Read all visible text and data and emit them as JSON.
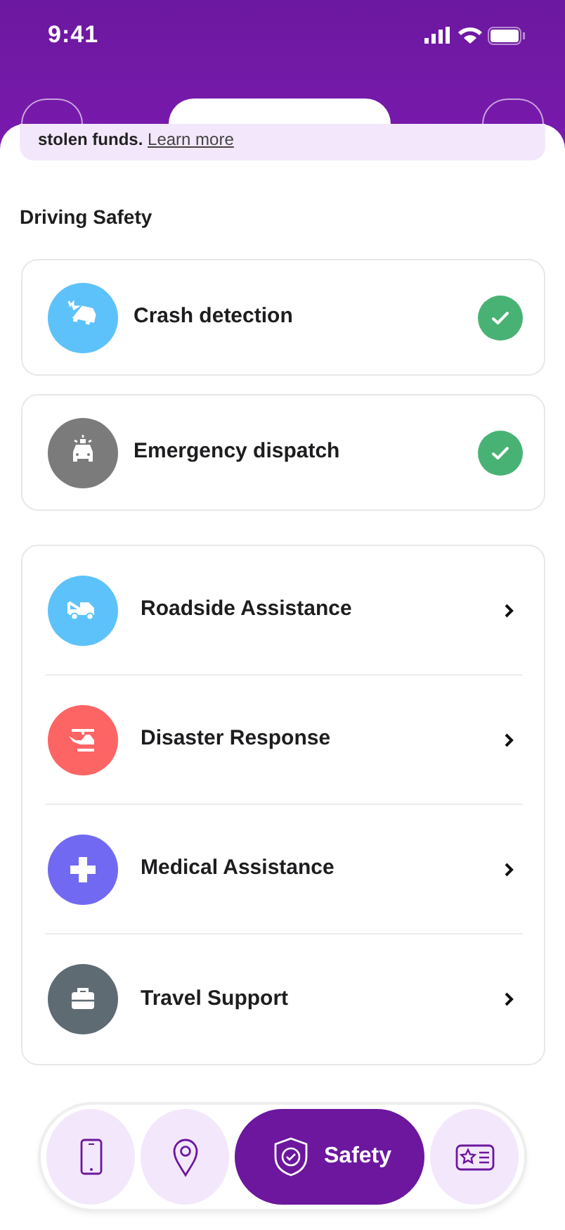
{
  "status_bar": {
    "time": "9:41"
  },
  "banner": {
    "text": "stolen funds.",
    "link": "Learn more"
  },
  "section_title": "Driving Safety",
  "features": [
    {
      "label": "Crash detection",
      "kind": "crash",
      "color": "#5ec2fa",
      "checked": true
    },
    {
      "label": "Emergency dispatch",
      "kind": "dispatch",
      "color": "#7b7b7b",
      "checked": true
    }
  ],
  "services": [
    {
      "label": "Roadside Assistance",
      "kind": "tow",
      "color": "#5ec2fa"
    },
    {
      "label": "Disaster Response",
      "kind": "helicopter",
      "color": "#fd6464"
    },
    {
      "label": "Medical Assistance",
      "kind": "medical",
      "color": "#7269f2"
    },
    {
      "label": "Travel Support",
      "kind": "briefcase",
      "color": "#5f6b73"
    }
  ],
  "nav": [
    {
      "kind": "phone",
      "selected": false
    },
    {
      "kind": "location",
      "selected": false
    },
    {
      "kind": "safety",
      "label": "Safety",
      "selected": true
    },
    {
      "kind": "card",
      "selected": false
    }
  ]
}
